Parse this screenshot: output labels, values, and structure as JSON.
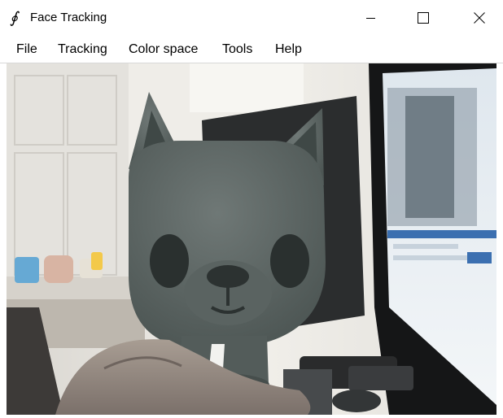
{
  "window": {
    "title": "Face Tracking",
    "app_icon": "script-f-icon",
    "controls": {
      "minimize_icon": "minimize-icon",
      "maximize_icon": "maximize-icon",
      "close_icon": "close-icon"
    }
  },
  "menu": {
    "items": [
      {
        "label": "File"
      },
      {
        "label": "Tracking"
      },
      {
        "label": "Color space"
      },
      {
        "label": "Tools"
      },
      {
        "label": "Help"
      }
    ]
  },
  "camera_feed": {
    "content": "webcam-frame"
  },
  "colors": {
    "figure_body": "#5d6664",
    "figure_shadow": "#3a4241",
    "wall": "#e6e4de",
    "monitor": "#151617"
  }
}
